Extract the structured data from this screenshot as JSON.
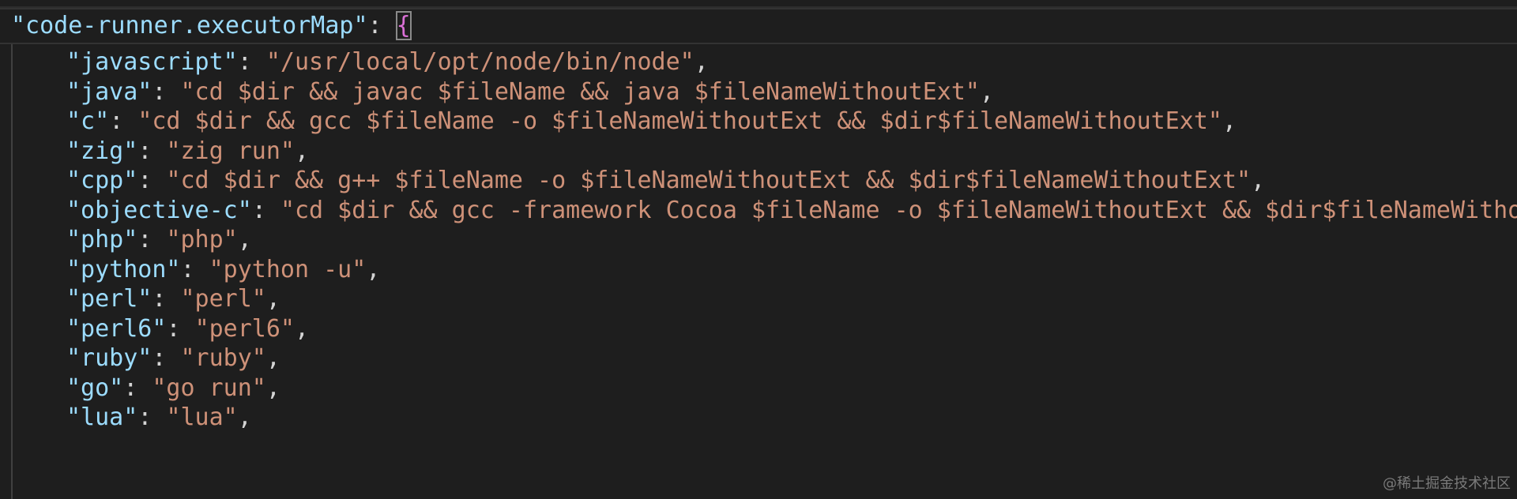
{
  "editor": {
    "header_key": "\"code-runner.executorMap\"",
    "header_colon": ": ",
    "header_brace": "{",
    "entries": [
      {
        "key": "\"javascript\"",
        "value": "\"/usr/local/opt/node/bin/node\"",
        "trail": ","
      },
      {
        "key": "\"java\"",
        "value": "\"cd $dir && javac $fileName && java $fileNameWithoutExt\"",
        "trail": ","
      },
      {
        "key": "\"c\"",
        "value": "\"cd $dir && gcc $fileName -o $fileNameWithoutExt && $dir$fileNameWithoutExt\"",
        "trail": ","
      },
      {
        "key": "\"zig\"",
        "value": "\"zig run\"",
        "trail": ","
      },
      {
        "key": "\"cpp\"",
        "value": "\"cd $dir && g++ $fileName -o $fileNameWithoutExt && $dir$fileNameWithoutExt\"",
        "trail": ","
      },
      {
        "key": "\"objective-c\"",
        "value": "\"cd $dir && gcc -framework Cocoa $fileName -o $fileNameWithoutExt && $dir$fileNameWitho",
        "trail": ""
      },
      {
        "key": "\"php\"",
        "value": "\"php\"",
        "trail": ","
      },
      {
        "key": "\"python\"",
        "value": "\"python -u\"",
        "trail": ","
      },
      {
        "key": "\"perl\"",
        "value": "\"perl\"",
        "trail": ","
      },
      {
        "key": "\"perl6\"",
        "value": "\"perl6\"",
        "trail": ","
      },
      {
        "key": "\"ruby\"",
        "value": "\"ruby\"",
        "trail": ","
      },
      {
        "key": "\"go\"",
        "value": "\"go run\"",
        "trail": ","
      },
      {
        "key": "\"lua\"",
        "value": "\"lua\"",
        "trail": ","
      }
    ],
    "colon": ": "
  },
  "watermark": "@稀土掘金技术社区",
  "colors": {
    "background": "#1e1e1e",
    "key": "#9cdcfe",
    "string": "#ce9178",
    "punctuation": "#d4d4d4",
    "brace": "#da70d6"
  }
}
